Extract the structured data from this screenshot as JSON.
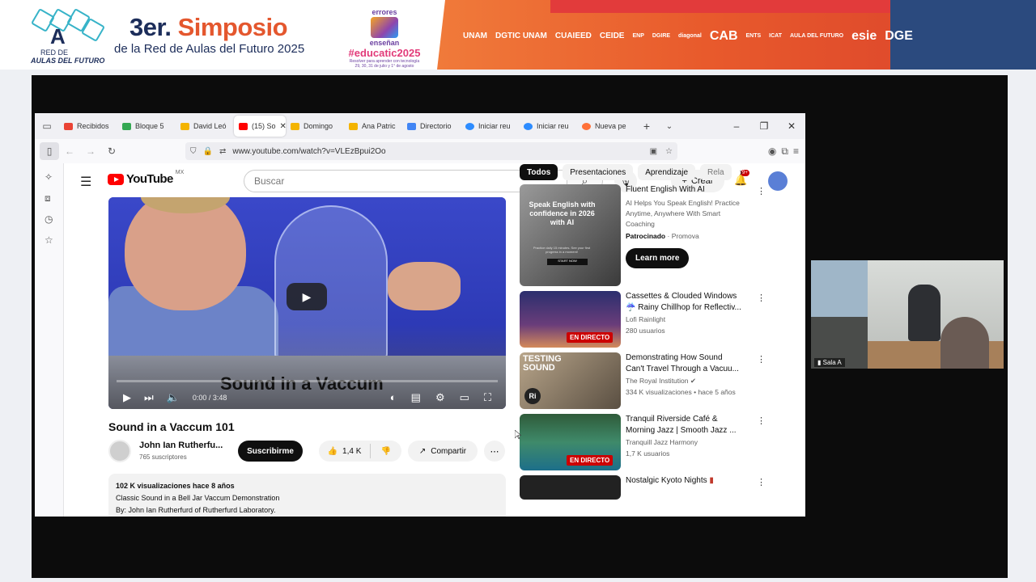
{
  "banner": {
    "logo_line1": "RED DE",
    "logo_line2": "AULAS DEL FUTURO",
    "title_prefix": "3er.",
    "title_accent": "Simposio",
    "subtitle": "de la Red de Aulas del Futuro 2025",
    "edu_line1": "errores",
    "edu_line2": "enseñan",
    "edu_hashtag": "#educatic2025",
    "edu_line3": "Resolver para aprender con tecnología",
    "edu_line4": "29, 30, 31 de julio y 1° de agosto",
    "partners": [
      "UNAM",
      "DGTIC UNAM",
      "CUAIEED",
      "CEIDE",
      "ENP",
      "DGIRE",
      "diagonal",
      "CAB",
      "ENTS",
      "ICAT",
      "AULA DEL FUTURO",
      "esie",
      "DGE"
    ],
    "colors": {
      "orange": "#f07a3a",
      "navy": "#1c2d5a",
      "accent": "#e4572e"
    }
  },
  "camera": {
    "label": "Sala A"
  },
  "browser": {
    "tabs": [
      {
        "label": "Recibidos",
        "color": "#ea4335"
      },
      {
        "label": "Bloque 5",
        "color": "#34a853"
      },
      {
        "label": "David Leó",
        "color": "#f4b400"
      },
      {
        "label": "(15) So",
        "color": "#ff0000",
        "active": true
      },
      {
        "label": "Domingo",
        "color": "#f4b400"
      },
      {
        "label": "Ana Patric",
        "color": "#f4b400"
      },
      {
        "label": "Directorio",
        "color": "#4285f4"
      },
      {
        "label": "Iniciar reu",
        "color": "#2d8cff"
      },
      {
        "label": "Iniciar reu",
        "color": "#2d8cff"
      },
      {
        "label": "Nueva pe",
        "color": "#ff7139"
      }
    ],
    "url": "www.youtube.com/watch?v=VLEzBpui2Oo"
  },
  "youtube": {
    "logo_text": "YouTube",
    "region": "MX",
    "search_placeholder": "Buscar",
    "create_label": "Crear",
    "notifications": "9+",
    "video": {
      "caption": "Sound in a Vaccum",
      "time": "0:00 / 3:48",
      "title": "Sound in a Vaccum 101"
    },
    "channel": {
      "name": "John Ian Rutherfu...",
      "subscribers": "765 suscriptores",
      "subscribe_label": "Suscribirme",
      "likes": "1,4 K",
      "share_label": "Compartir"
    },
    "description": {
      "stats": "102 K visualizaciones  hace 8 años",
      "line1": "Classic Sound in a Bell Jar Vaccum Demonstration",
      "line2": "By: John Ian Rutherfurd of Rutherfurd Laboratory."
    },
    "chips": [
      "Todos",
      "Presentaciones",
      "Aprendizaje",
      "Rela"
    ],
    "recommendations": {
      "ad": {
        "title": "Fluent English With AI",
        "desc1": "AI Helps You Speak English! Practice",
        "desc2": "Anytime, Anywhere With Smart",
        "desc3": "Coaching",
        "sponsored": "Patrocinado",
        "advertiser": "Promova",
        "button": "Learn more",
        "thumb_text": "Speak English with confidence in 2026 with AI",
        "thumb_small": "Practice daily 15 minutes. See your first progress in a moment!",
        "thumb_button": "START NOW"
      },
      "items": [
        {
          "title1": "Cassettes & Clouded Windows",
          "title2": "☔ Rainy Chillhop for Reflectiv...",
          "channel": "Lofi Rainlight",
          "meta": "280 usuarios",
          "live": "EN DIRECTO"
        },
        {
          "title1": "Demonstrating How Sound",
          "title2": "Can't Travel Through a Vacuu...",
          "channel": "The Royal Institution",
          "meta": "334 K visualizaciones • hace 5 años",
          "thumb_text1": "TESTING",
          "thumb_text2": "SOUND",
          "badge": "Ri"
        },
        {
          "title1": "Tranquil Riverside Café &",
          "title2": "Morning Jazz | Smooth Jazz ...",
          "channel": "Tranquill Jazz Harmony",
          "meta": "1,7 K usuarios",
          "live": "EN DIRECTO"
        },
        {
          "title1": "Nostalgic Kyoto Nights"
        }
      ]
    }
  }
}
